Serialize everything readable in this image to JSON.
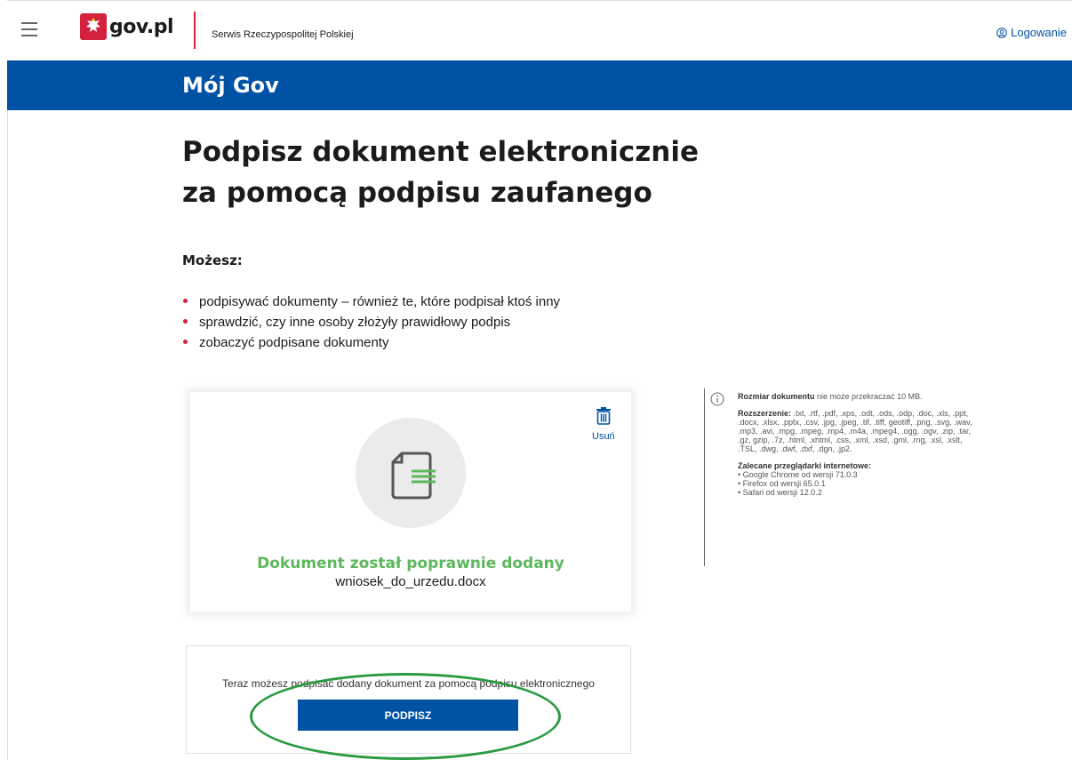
{
  "header": {
    "logo_text": "gov.pl",
    "service_name": "Serwis Rzeczypospolitej Polskiej",
    "login_label": "Logowanie"
  },
  "band": {
    "title": "Mój Gov"
  },
  "main": {
    "title_line1": "Podpisz dokument elektronicznie",
    "title_line2": "za pomocą podpisu zaufanego",
    "can_heading": "Możesz:",
    "bullets": [
      "podpisywać dokumenty – również te, które podpisał ktoś inny",
      "sprawdzić, czy inne osoby złożyły prawidłowy podpis",
      "zobaczyć podpisane dokumenty"
    ]
  },
  "document": {
    "delete_label": "Usuń",
    "success_message": "Dokument został poprawnie dodany",
    "file_name": "wniosek_do_urzedu.docx"
  },
  "info": {
    "size_label": "Rozmiar dokumentu",
    "size_text": "nie może przekraczać 10 MB.",
    "ext_label": "Rozszerzenie:",
    "ext_list": ".txt, .rtf, .pdf, .xps, .odt, .ods, .odp, .doc, .xls, .ppt, .docx, .xlsx, .pptx, .csv, .jpg, .jpeg, .tif, .tiff, geotiff, .png, .svg, .wav, .mp3, .avi, .mpg, .mpeg, .mp4, .m4a, .mpeg4, .ogg, .ogv, .zip, .tar, .gz, gzip, .7z, .html, .xhtml, .css, .xml, .xsd, .gml, .rng, .xsl, .xslt, .TSL, .dwg, .dwf, .dxf, .dgn, .jp2.",
    "browsers_label": "Zalecane przeglądarki internetowe:",
    "browsers": [
      "• Google Chrome od wersji 71.0.3",
      "• Firefox od wersji 65.0.1",
      "• Safari od wersji 12.0.2"
    ]
  },
  "sign": {
    "prompt": "Teraz możesz podpisać dodany dokument za pomocą podpisu elektronicznego",
    "button_label": "PODPISZ"
  },
  "colors": {
    "brand_blue": "#0052a5",
    "brand_red": "#d4213d",
    "success_green": "#5cb85c",
    "annotation_green": "#2a9a40"
  },
  "icons": [
    "menu-icon",
    "eagle-emblem-icon",
    "user-circle-icon",
    "document-icon",
    "trash-icon",
    "info-icon"
  ]
}
